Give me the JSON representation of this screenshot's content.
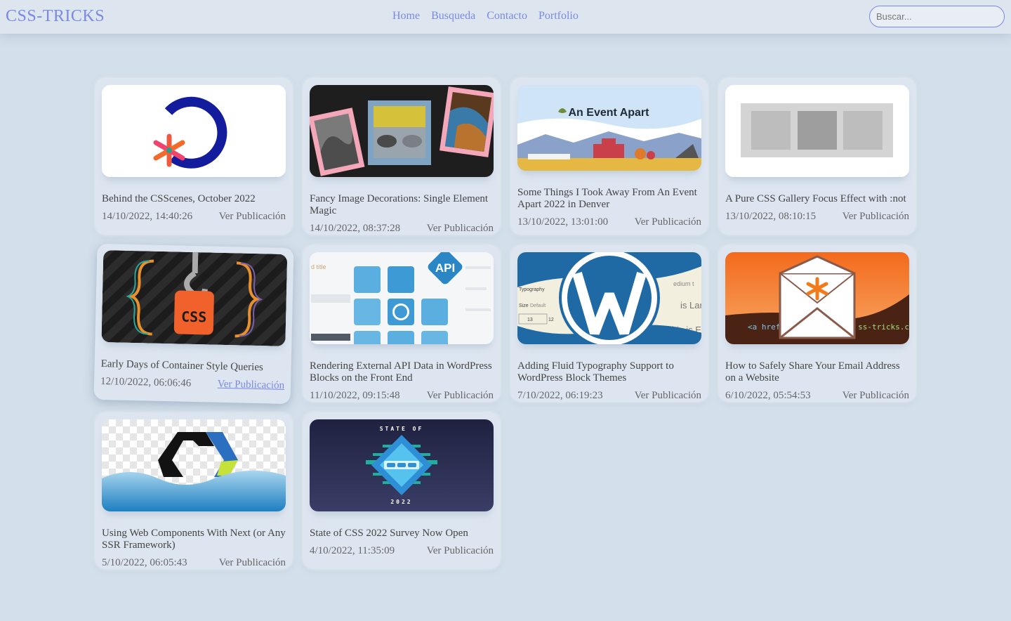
{
  "header": {
    "logo": "CSS-TRICKS",
    "nav": [
      "Home",
      "Busqueda",
      "Contacto",
      "Portfolio"
    ],
    "search_placeholder": "Buscar..."
  },
  "link_label": "Ver Publicación",
  "posts": [
    {
      "title": "Behind the CSScenes, October 2022",
      "date": "14/10/2022, 14:40:26",
      "image": "csscenes-logo"
    },
    {
      "title": "Fancy Image Decorations: Single Element Magic",
      "date": "14/10/2022, 08:37:28",
      "image": "framed-photos"
    },
    {
      "title": "Some Things I Took Away From An Event Apart 2022 in Denver",
      "date": "13/10/2022, 13:01:00",
      "image": "event-apart-banner",
      "banner_text": "An Event Apart"
    },
    {
      "title": "A Pure CSS Gallery Focus Effect with :not",
      "date": "13/10/2022, 08:10:15",
      "image": "gallery-boxes"
    },
    {
      "title": "Early Days of Container Style Queries",
      "date": "12/10/2022, 06:06:46",
      "image": "css-hook",
      "badge_text": "CSS"
    },
    {
      "title": "Rendering External API Data in WordPress Blocks on the Front End",
      "date": "11/10/2022, 09:15:48",
      "image": "api-blocks",
      "badge_text": "API",
      "background_text": "d title"
    },
    {
      "title": "Adding Fluid Typography Support to WordPress Block Themes",
      "date": "7/10/2022, 06:19:23",
      "image": "wordpress-typography",
      "panel_labels": [
        "Typography",
        "Size",
        "Default",
        "13",
        "12",
        "edium t",
        "is Larg",
        "his is Ex"
      ]
    },
    {
      "title": "How to Safely Share Your Email Address on a Website",
      "date": "6/10/2022, 05:54:53",
      "image": "email-envelope",
      "code_left": "<a href",
      "code_right": "ss-tricks.c"
    },
    {
      "title": "Using Web Components With Next (or Any SSR Framework)",
      "date": "5/10/2022, 06:05:43",
      "image": "web-components-logo"
    },
    {
      "title": "State of CSS 2022 Survey Now Open",
      "date": "4/10/2022, 11:35:09",
      "image": "state-of-css",
      "top_text": "STATE OF",
      "bottom_text": "2022"
    }
  ]
}
